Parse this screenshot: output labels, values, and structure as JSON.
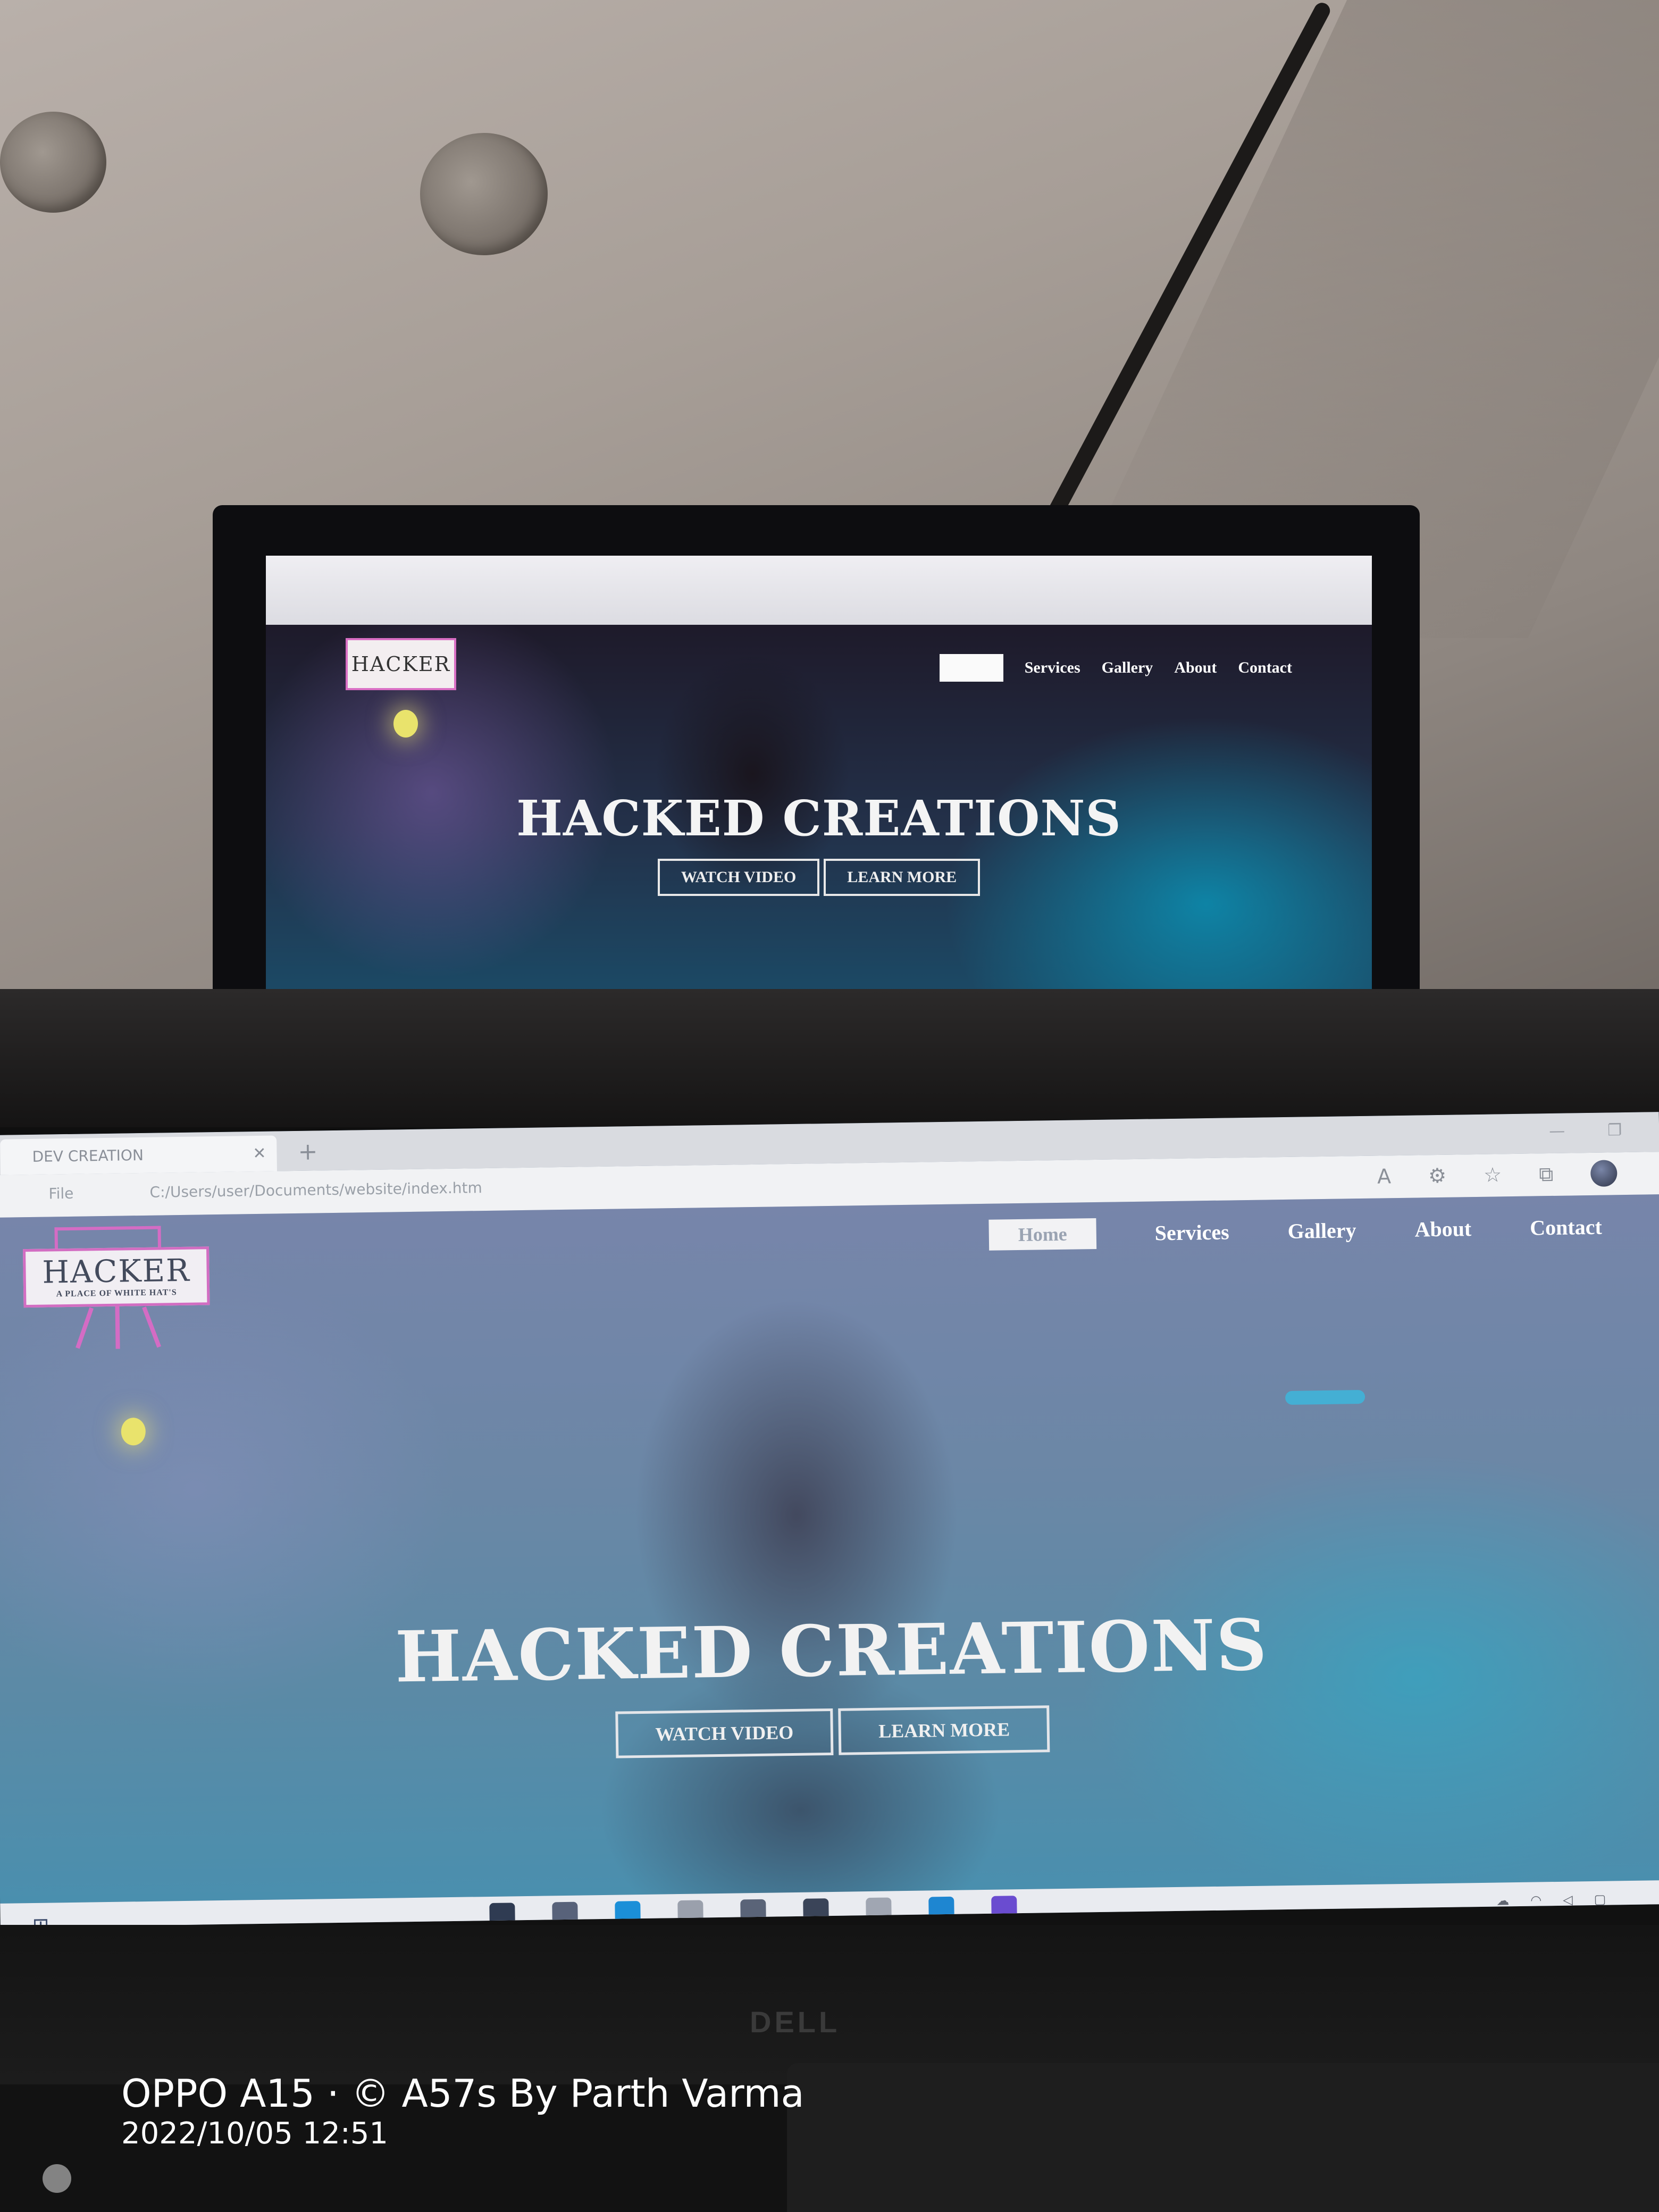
{
  "back_monitor": {
    "logo_text": "HACKER",
    "nav": [
      "Services",
      "Gallery",
      "About",
      "Contact"
    ],
    "hero_title": "HACKED CREATIONS",
    "buttons": [
      "WATCH VIDEO",
      "LEARN MORE"
    ]
  },
  "laptop": {
    "tab_title": "DEV CREATION",
    "address_info": "File",
    "url": "C:/Users/user/Documents/website/index.htm",
    "logo_title": "HACKER",
    "logo_subtitle": "A PLACE OF WHITE HAT'S",
    "nav": {
      "home": "Home",
      "items": [
        "Services",
        "Gallery",
        "About",
        "Contact"
      ]
    },
    "hero_title": "HACKED CREATIONS",
    "buttons": {
      "watch": "WATCH VIDEO",
      "learn": "LEARN MORE"
    },
    "taskbar_icon_colors": [
      "#2f3b52",
      "#58627a",
      "#1b8fd8",
      "#9aa0ac",
      "#5a6478",
      "#3a4458",
      "#a0a6b2",
      "#1e86d1",
      "#6a4cd0"
    ],
    "brand": "DELL"
  },
  "watermark": {
    "device": "OPPO A15 · © A57s By Parth Varma",
    "datetime": "2022/10/05 12:51"
  },
  "colors": {
    "logo_accent": "#d46cc4",
    "hero_cyan": "#3ab9e0"
  }
}
